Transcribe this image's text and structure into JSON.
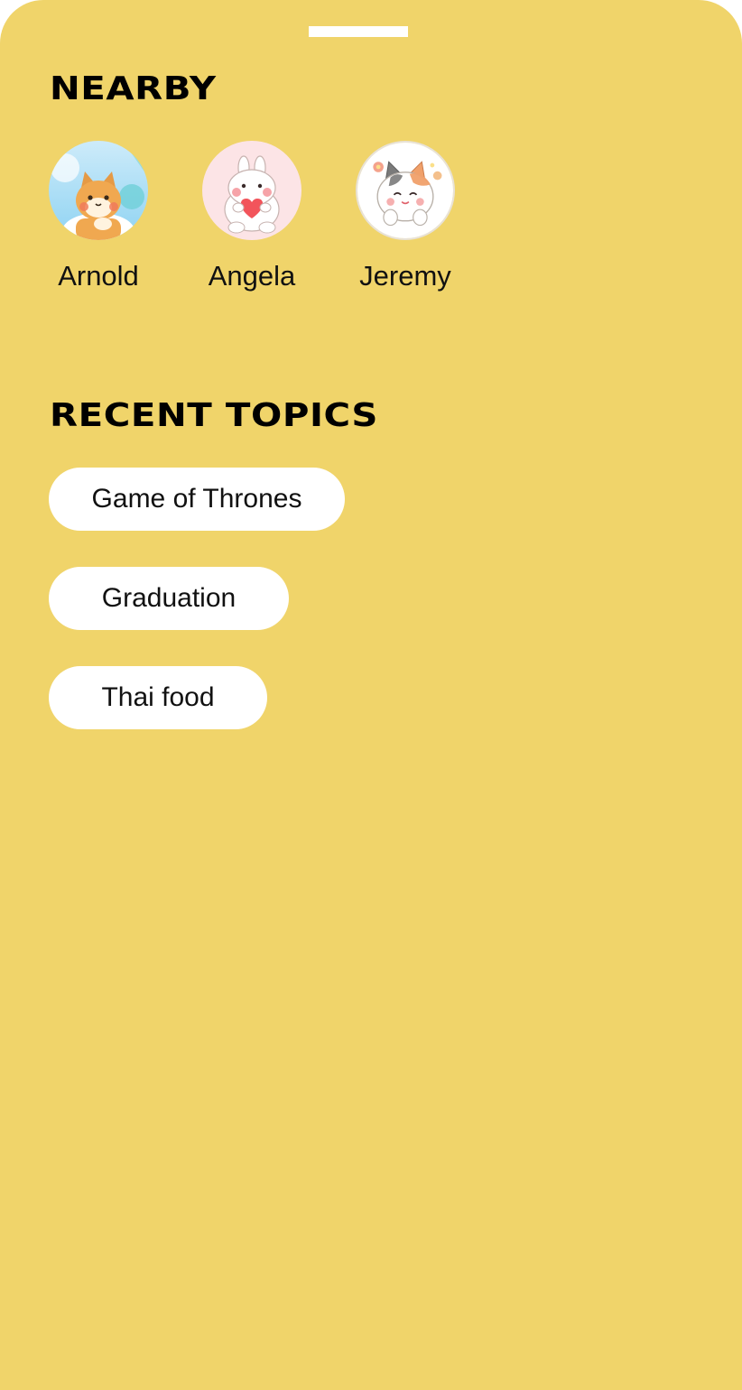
{
  "nearby": {
    "title": "NEARBY",
    "people": [
      {
        "name": "Arnold",
        "avatar": "shiba-dog-icon"
      },
      {
        "name": "Angela",
        "avatar": "bunny-heart-icon"
      },
      {
        "name": "Jeremy",
        "avatar": "calico-cat-icon"
      }
    ]
  },
  "topics": {
    "title": "RECENT TOPICS",
    "items": [
      {
        "label": "Game of Thrones"
      },
      {
        "label": "Graduation"
      },
      {
        "label": "Thai food"
      }
    ]
  },
  "colors": {
    "background": "#F0D46A",
    "chip": "#FFFFFF",
    "text": "#111111"
  }
}
